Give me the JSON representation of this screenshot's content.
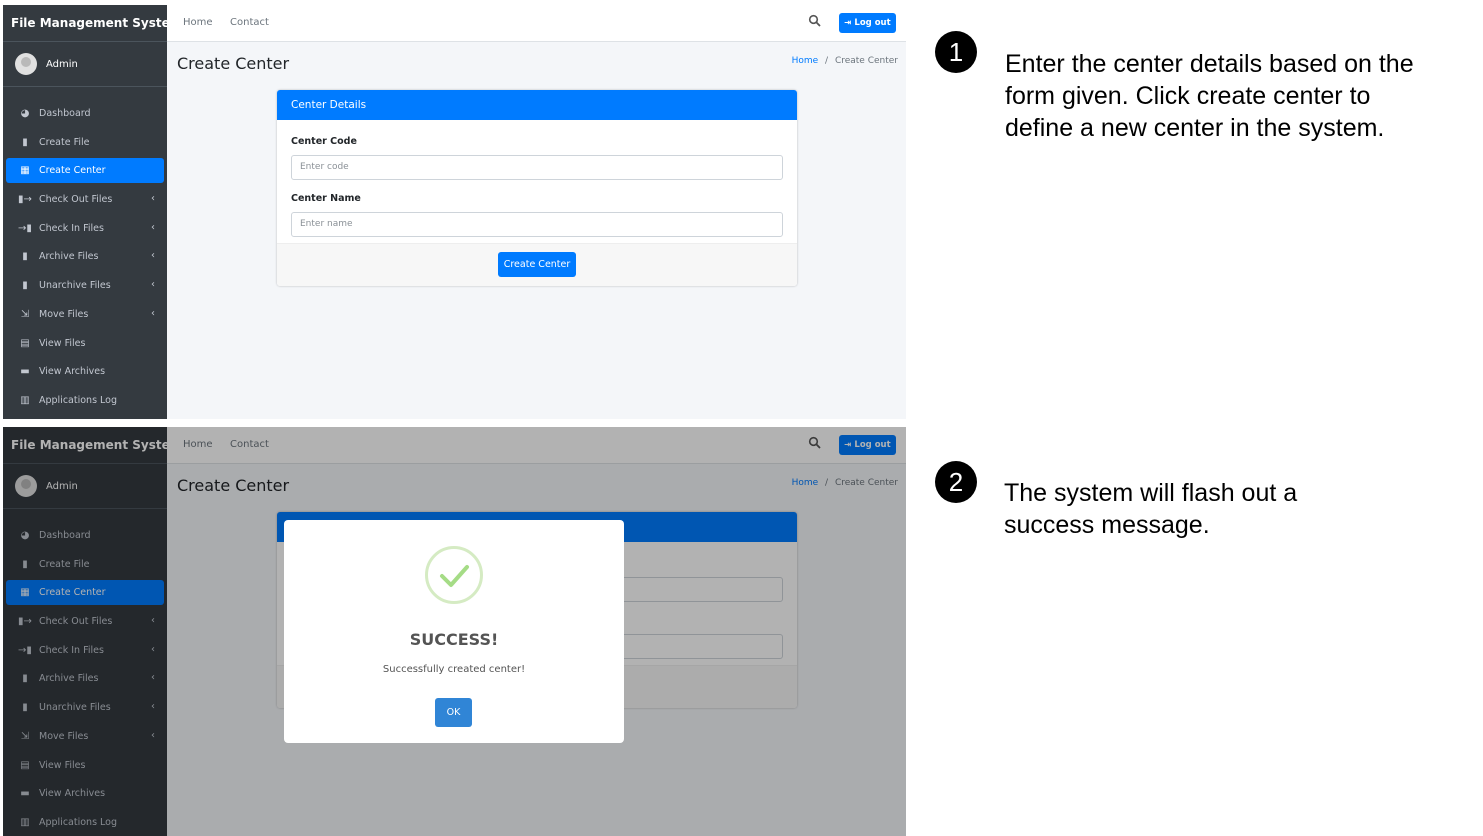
{
  "steps": [
    {
      "number": "1",
      "text": "Enter the center details based on the form given. Click create center to define a new center in the system."
    },
    {
      "number": "2",
      "text": "The system will flash out a success message."
    }
  ],
  "app": {
    "brand": "File Management System",
    "user": "Admin",
    "sidebar": [
      {
        "label": "Dashboard",
        "icon": "dashboard-icon",
        "glyph": "◕"
      },
      {
        "label": "Create File",
        "icon": "file-icon",
        "glyph": "▮"
      },
      {
        "label": "Create Center",
        "icon": "building-icon",
        "glyph": "▦",
        "active": true
      },
      {
        "label": "Check Out Files",
        "icon": "file-export-icon",
        "glyph": "▮→",
        "arrow": "‹"
      },
      {
        "label": "Check In Files",
        "icon": "file-import-icon",
        "glyph": "→▮",
        "arrow": "‹"
      },
      {
        "label": "Archive Files",
        "icon": "file-archive-icon",
        "glyph": "▮",
        "arrow": "‹"
      },
      {
        "label": "Unarchive Files",
        "icon": "file-archive-icon",
        "glyph": "▮",
        "arrow": "‹"
      },
      {
        "label": "Move Files",
        "icon": "dolly-icon",
        "glyph": "⇲",
        "arrow": "‹"
      },
      {
        "label": "View Files",
        "icon": "file-alt-icon",
        "glyph": "▤"
      },
      {
        "label": "View Archives",
        "icon": "archive-icon",
        "glyph": "▬"
      },
      {
        "label": "Applications Log",
        "icon": "clipboard-icon",
        "glyph": "▥"
      }
    ],
    "topnav": {
      "home": "Home",
      "contact": "Contact",
      "logout": "Log out"
    },
    "page_title": "Create Center",
    "breadcrumb": {
      "home": "Home",
      "separator": "/",
      "current": "Create Center"
    },
    "form": {
      "header": "Center Details",
      "code_label": "Center Code",
      "code_placeholder": "Enter code",
      "name_label": "Center Name",
      "name_placeholder": "Enter name",
      "submit": "Create Center"
    },
    "modal": {
      "title": "SUCCESS!",
      "message": "Successfully created center!",
      "ok": "OK"
    }
  },
  "colors": {
    "primary": "#007bff",
    "sidebar": "#343a40",
    "success_check": "#a5dc86",
    "ok_button": "#3085d6"
  }
}
